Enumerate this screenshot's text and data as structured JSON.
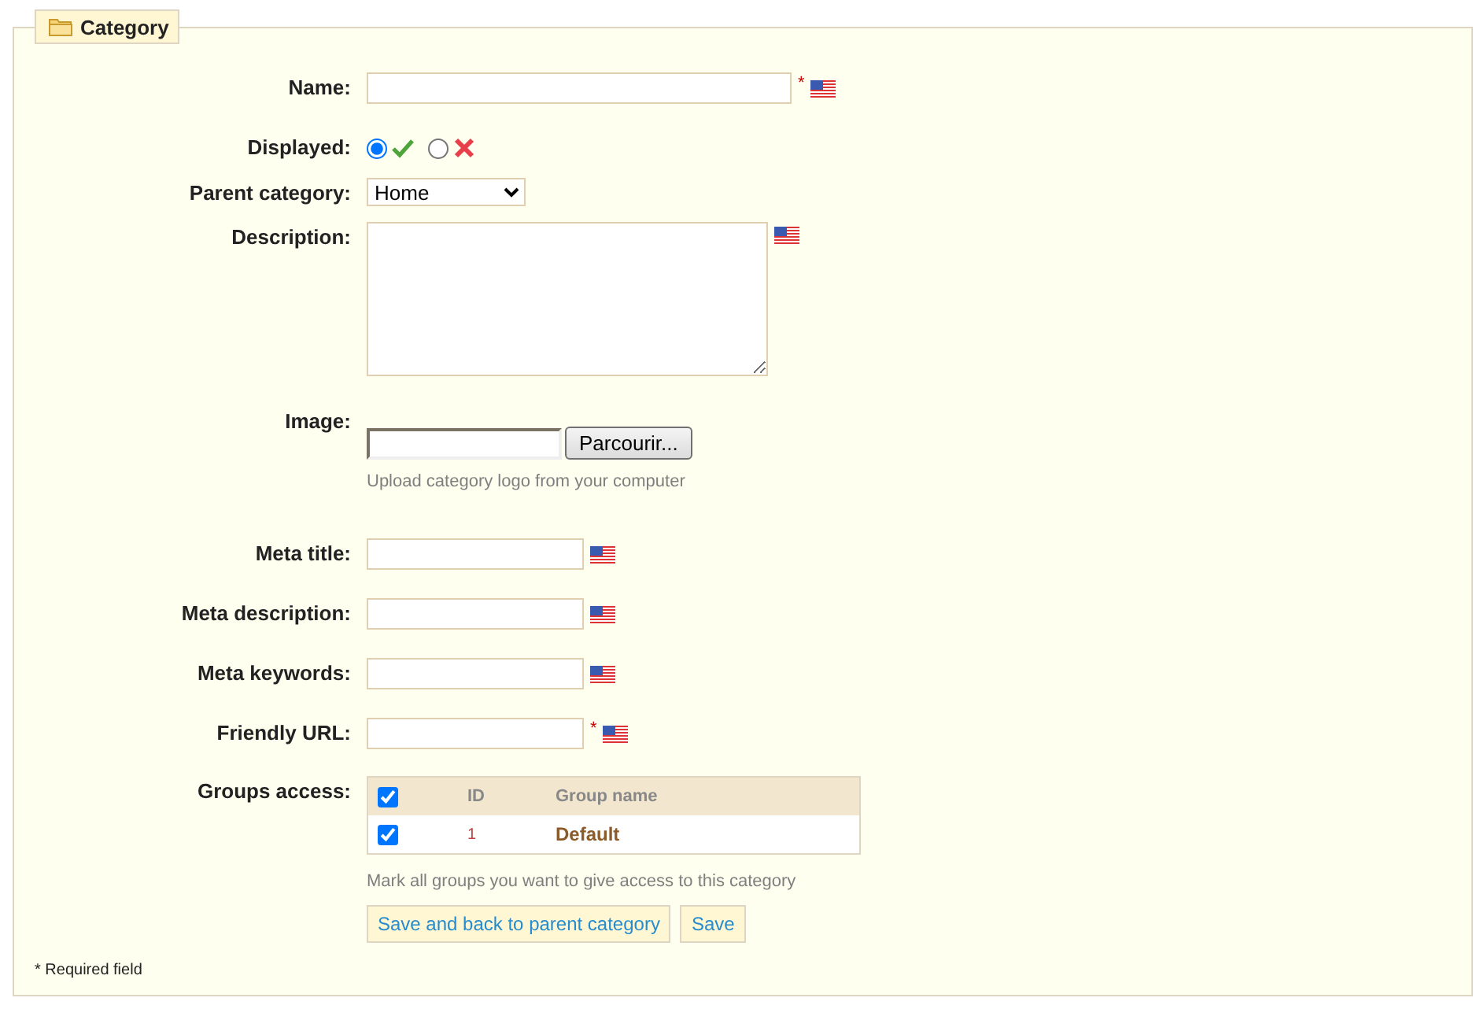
{
  "panel": {
    "title": "Category"
  },
  "fields": [
    {
      "kind": "text",
      "label": "Name:",
      "required_mark": "*",
      "translatable": true
    },
    {
      "kind": "radio",
      "label": "Displayed:",
      "options": [
        {
          "kind": "yes",
          "selected": true
        },
        {
          "kind": "no",
          "selected": false
        }
      ]
    },
    {
      "kind": "select",
      "label": "Parent category:",
      "value": "Home"
    },
    {
      "kind": "textarea",
      "label": "Description:",
      "translatable": true
    },
    {
      "kind": "file",
      "label": "Image:",
      "button": "Parcourir...",
      "hint": "Upload category logo from your computer"
    },
    {
      "kind": "text",
      "label": "Meta title:",
      "translatable": true
    },
    {
      "kind": "text",
      "label": "Meta description:",
      "translatable": true
    },
    {
      "kind": "text",
      "label": "Meta keywords:",
      "translatable": true
    },
    {
      "kind": "text",
      "label": "Friendly URL:",
      "required_mark": "*",
      "translatable": true
    },
    {
      "kind": "groups",
      "label": "Groups access:",
      "header_checked": true,
      "columns": [
        "ID",
        "Group name"
      ],
      "rows": [
        {
          "checked": true,
          "id": "1",
          "name": "Default"
        }
      ],
      "hint": "Mark all groups you want to give access to this category"
    }
  ],
  "buttons": [
    "Save and back to parent category",
    "Save"
  ],
  "footnote": "* Required field"
}
